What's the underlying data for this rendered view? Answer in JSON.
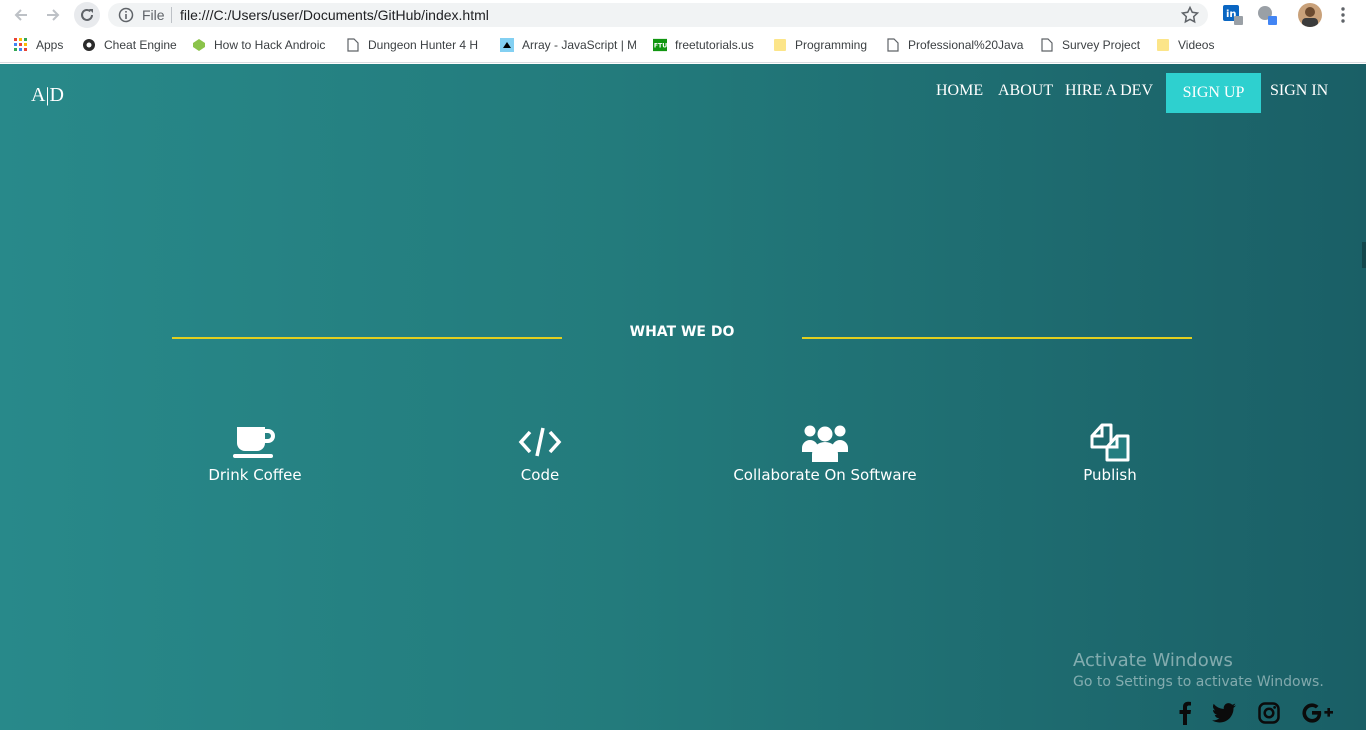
{
  "browser": {
    "omnibox": {
      "scheme_label": "File",
      "url": "file:///C:/Users/user/Documents/GitHub/index.html"
    },
    "bookmarks": [
      {
        "label": "Apps",
        "icon": "apps-grid-icon"
      },
      {
        "label": "Cheat Engine",
        "icon": "cheat-engine-icon"
      },
      {
        "label": "How to Hack Androic",
        "icon": "android-icon"
      },
      {
        "label": "Dungeon Hunter 4 H",
        "icon": "page-icon"
      },
      {
        "label": "Array - JavaScript | M",
        "icon": "mdn-icon"
      },
      {
        "label": "freetutorials.us",
        "icon": "ftu-icon"
      },
      {
        "label": "Programming",
        "icon": "folder-icon"
      },
      {
        "label": "Professional%20Java",
        "icon": "page-icon"
      },
      {
        "label": "Survey Project",
        "icon": "page-icon"
      },
      {
        "label": "Videos",
        "icon": "folder-icon"
      }
    ]
  },
  "site": {
    "logo": "A|D",
    "nav": {
      "home": "HOME",
      "about": "ABOUT",
      "hire": "HIRE A DEV",
      "signup": "SIGN UP",
      "signin": "SIGN IN"
    },
    "section_title": "WHAT WE DO",
    "features": [
      {
        "label": "Drink Coffee",
        "icon": "coffee-icon"
      },
      {
        "label": "Code",
        "icon": "code-icon"
      },
      {
        "label": "Collaborate On Software",
        "icon": "users-icon"
      },
      {
        "label": "Publish",
        "icon": "copy-files-icon"
      }
    ],
    "social": [
      "facebook-icon",
      "twitter-icon",
      "instagram-icon",
      "google-plus-icon"
    ]
  },
  "os_overlay": {
    "title": "Activate Windows",
    "subtitle": "Go to Settings to activate Windows."
  },
  "colors": {
    "page_gradient_start": "#28898a",
    "page_gradient_end": "#1a5f66",
    "signup_bg": "#2ed0cf",
    "rule_color": "#e2cf1e"
  }
}
